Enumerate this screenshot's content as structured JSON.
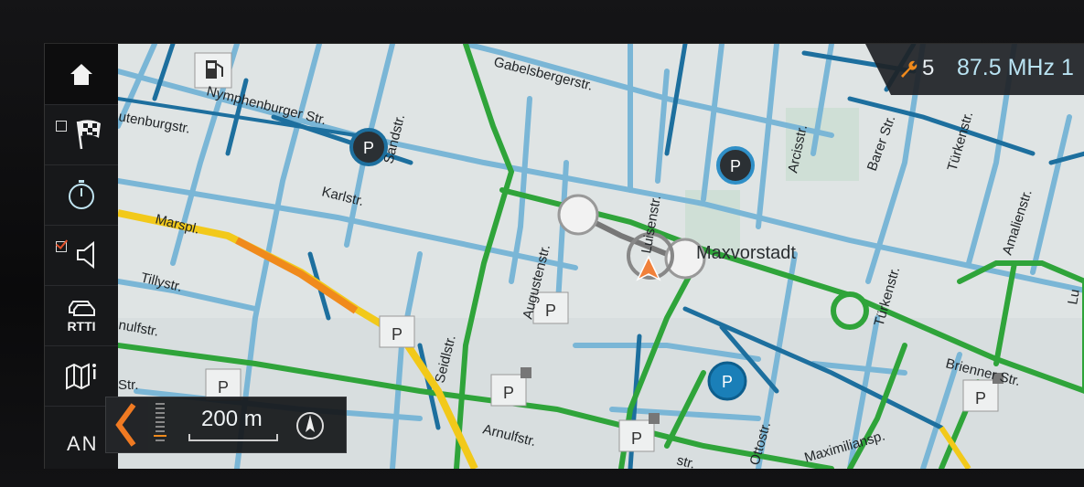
{
  "status": {
    "service_count": "5",
    "radio_frequency": "87.5 MHz",
    "trailing": "1"
  },
  "sidebar": {
    "items": [
      {
        "name": "home",
        "icon": "home-icon",
        "checkbox": null
      },
      {
        "name": "destination",
        "icon": "checkered-flag-icon",
        "checkbox": false
      },
      {
        "name": "timer",
        "icon": "stopwatch-icon",
        "checkbox": null
      },
      {
        "name": "voice",
        "icon": "speaker-icon",
        "checkbox": true
      },
      {
        "name": "rtti",
        "icon": "traffic-cars-icon",
        "label": "RTTI",
        "checkbox": null
      },
      {
        "name": "map-info",
        "icon": "map-info-icon",
        "checkbox": null
      },
      {
        "name": "an",
        "label": "AN",
        "checkbox": null
      }
    ]
  },
  "map": {
    "district": "Maxvorstadt",
    "streets": [
      "Gabelsbergerstr.",
      "Nymphenburger Str.",
      "utenburgstr.",
      "Sandstr.",
      "Karlstr.",
      "Marspl.",
      "Tillystr.",
      "nulfstr.",
      "Str.",
      "Seidlstr.",
      "Augustenstr.",
      "Luisenstr.",
      "Arcisstr.",
      "Barer Str.",
      "Türkenstr.",
      "Amalienstr.",
      "Türkenstr.",
      "Brienner Str.",
      "Maximiliansp.",
      "Ottostr.",
      "Arnulfstr.",
      "str.",
      "Lu"
    ],
    "colors": {
      "background": "#dfe4e4",
      "road_blue_light": "#7ab6d6",
      "road_blue_dark": "#1d6f9e",
      "road_green": "#2fa43a",
      "road_yellow": "#f2c91a",
      "road_orange": "#f08a1c",
      "vehicle": "#f0803a"
    },
    "parking_symbol": "P"
  },
  "scale": {
    "distance": "200 m"
  }
}
